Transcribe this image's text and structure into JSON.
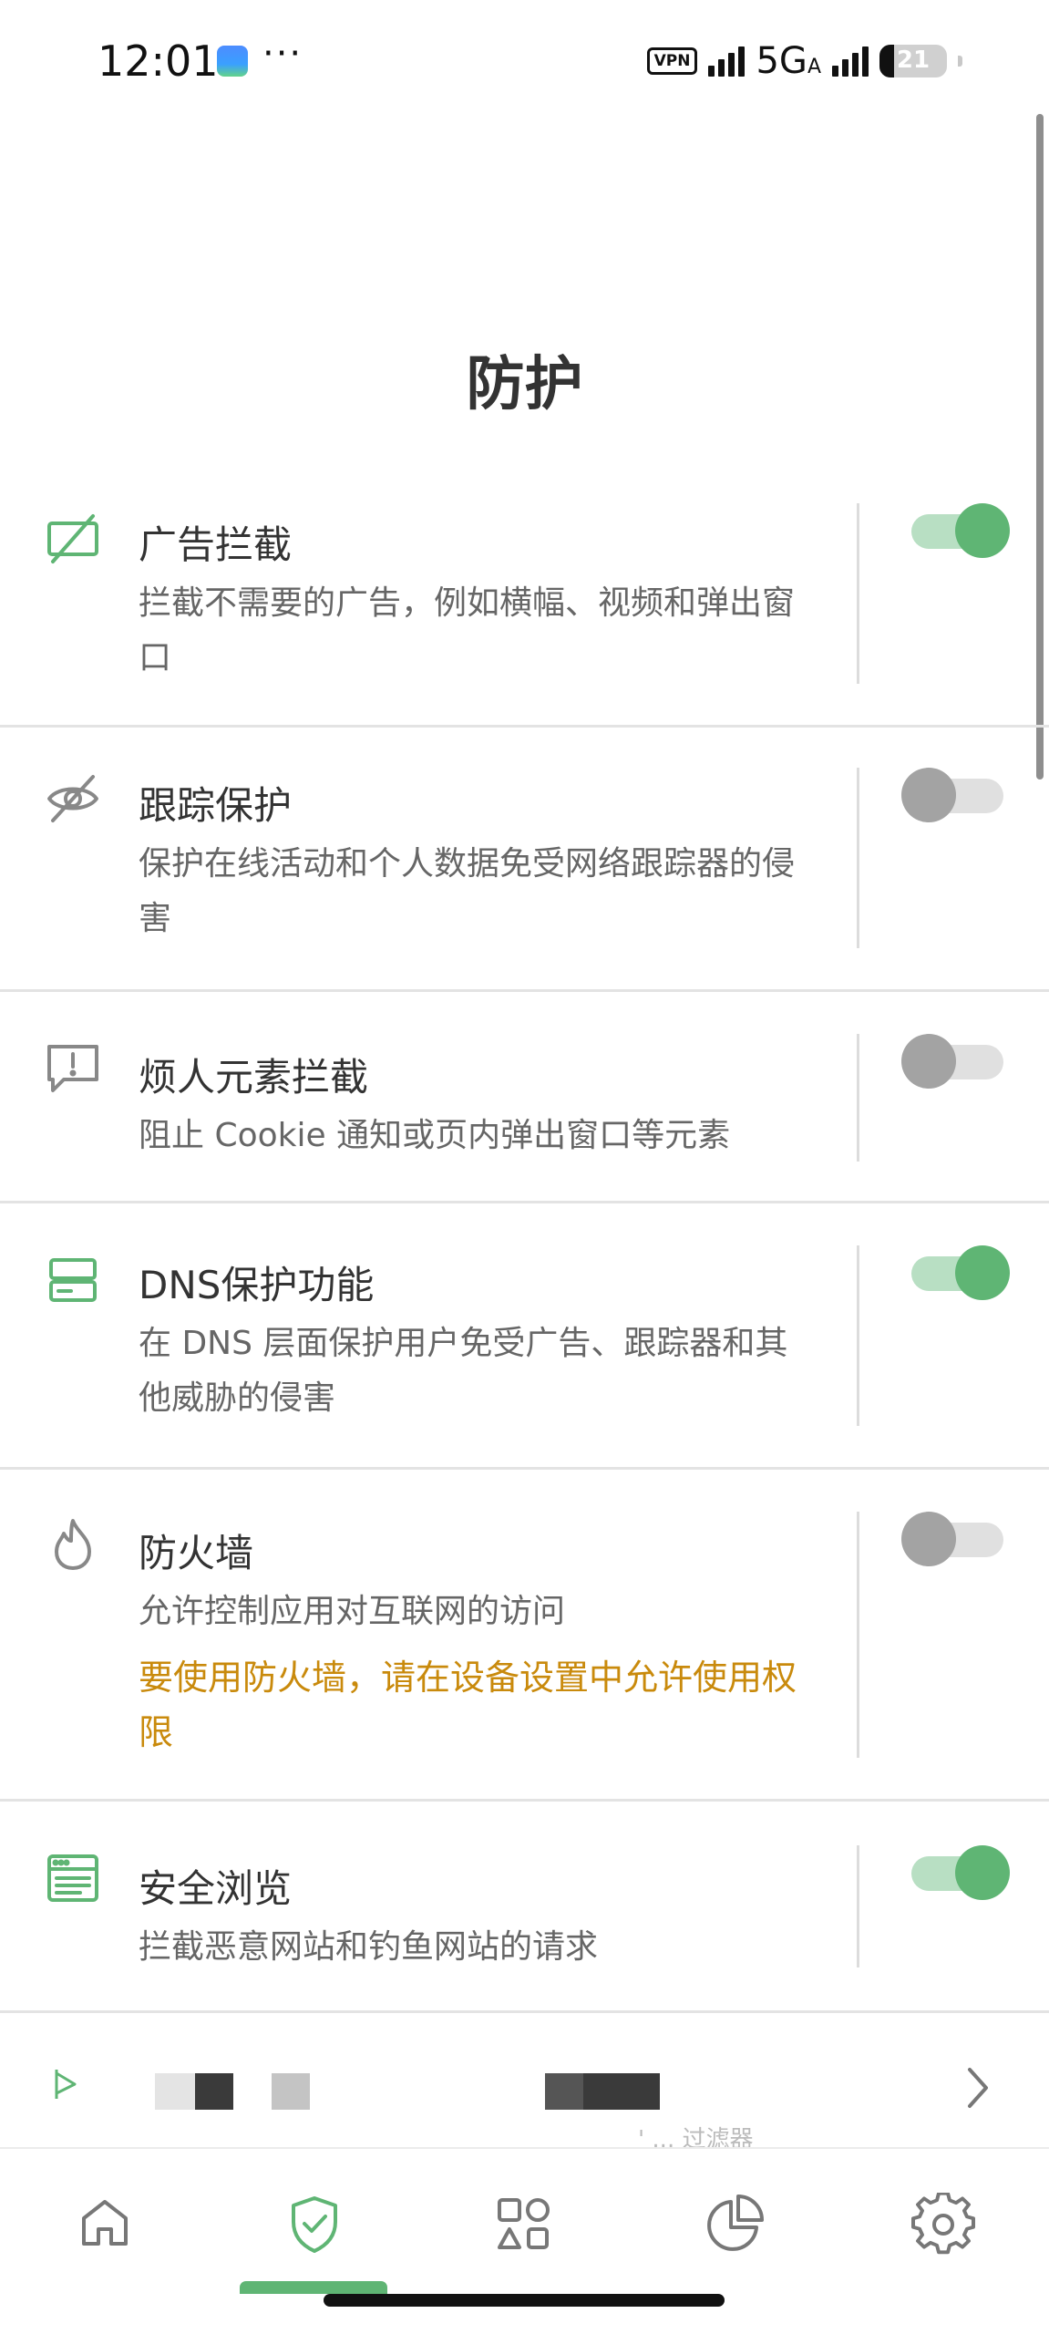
{
  "status_bar": {
    "time": "12:01",
    "more": "···",
    "vpn": "VPN",
    "network": "5G",
    "network_sub": "A",
    "battery": "21",
    "battery_level": 0.21
  },
  "page": {
    "title": "防护"
  },
  "features": [
    {
      "id": "ad-blocking",
      "title": "广告拦截",
      "description": "拦截不需要的广告，例如横幅、视频和弹出窗口",
      "enabled": true,
      "icon": "ad-block-icon"
    },
    {
      "id": "tracking-protection",
      "title": "跟踪保护",
      "description": "保护在线活动和个人数据免受网络跟踪器的侵害",
      "enabled": false,
      "icon": "eye-off-icon"
    },
    {
      "id": "annoyance-blocking",
      "title": "烦人元素拦截",
      "description": "阻止 Cookie 通知或页内弹出窗口等元素",
      "enabled": false,
      "icon": "alert-message-icon"
    },
    {
      "id": "dns-protection",
      "title": "DNS保护功能",
      "description": "在 DNS 层面保护用户免受广告、跟踪器和其他威胁的侵害",
      "enabled": true,
      "icon": "server-icon"
    },
    {
      "id": "firewall",
      "title": "防火墙",
      "description": "允许控制应用对互联网的访问",
      "warning": "要使用防火墙，请在设备设置中允许使用权限",
      "enabled": false,
      "icon": "flame-icon"
    },
    {
      "id": "safe-browsing",
      "title": "安全浏览",
      "description": "拦截恶意网站和钓鱼网站的请求",
      "enabled": true,
      "icon": "browser-window-icon"
    }
  ],
  "banner": {
    "text": "' ... 过滤器"
  },
  "bottom_nav": {
    "items": [
      {
        "name": "home",
        "icon": "home-icon"
      },
      {
        "name": "protection",
        "icon": "shield-check-icon",
        "active": true
      },
      {
        "name": "apps",
        "icon": "apps-grid-icon"
      },
      {
        "name": "statistics",
        "icon": "pie-chart-icon"
      },
      {
        "name": "settings",
        "icon": "gear-icon"
      }
    ]
  },
  "colors": {
    "accent": "#5fb574",
    "accent_light": "#b8dfc3",
    "warning": "#c98a0c",
    "toggle_off": "#a3a3a3",
    "divider": "#e3e3e3"
  }
}
